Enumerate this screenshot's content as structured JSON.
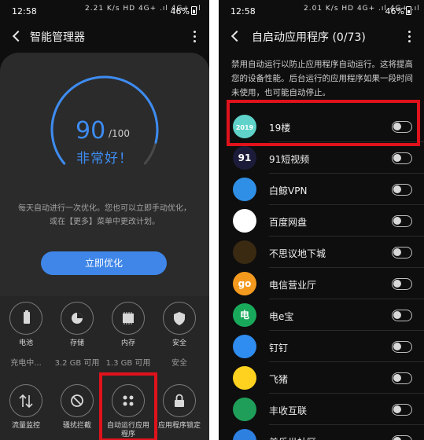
{
  "left_screen": {
    "status_bar": {
      "time": "12:58",
      "system_icons": "2.21 K/s HD 4G+ .ıl 4G+ .ıl",
      "battery": "46%"
    },
    "app_bar": {
      "title": "智能管理器"
    },
    "score": {
      "value": "90",
      "max": "/100",
      "fraction": 0.9,
      "status": "非常好！"
    },
    "description": "每天自动进行一次优化。您也可以立即手动优化，或在【更多】菜单中更改计划。",
    "optimize_button": "立即优化",
    "tiles_row1": [
      {
        "label": "电池",
        "value": "充电中...",
        "icon": "battery-icon"
      },
      {
        "label": "存储",
        "value": "3.2 GB 可用",
        "icon": "pie-chart-icon"
      },
      {
        "label": "内存",
        "value": "1.3 GB 可用",
        "icon": "memory-chip-icon"
      },
      {
        "label": "安全",
        "value": "安全",
        "icon": "shield-icon"
      }
    ],
    "tiles_row2": [
      {
        "label": "流量监控",
        "icon": "up-down-arrows-icon"
      },
      {
        "label": "骚扰拦截",
        "icon": "block-icon"
      },
      {
        "label": "自动运行应用程序",
        "icon": "apps-grid-icon"
      },
      {
        "label": "应用程序锁定",
        "icon": "lock-icon"
      }
    ],
    "highlight_color": "#e0121b",
    "accent_color": "#3d8cf2"
  },
  "right_screen": {
    "status_bar": {
      "time": "12:58",
      "system_icons": "2.01 K/s HD 4G+ .ıl 4G+ .ıl",
      "battery": "46%"
    },
    "app_bar": {
      "title": "自启动应用程序 (0/73)"
    },
    "intro": "禁用自动运行以防止应用程序自动运行。这将提高您的设备性能。后台运行的应用程序如果一段时间未使用，也可能自动停止。",
    "apps": [
      {
        "name": "19楼",
        "icon": "app-19lou-icon",
        "icon_text": "2019",
        "color": "#5fd3c9",
        "enabled": false
      },
      {
        "name": "91短视频",
        "icon": "app-91-icon",
        "icon_text": "91",
        "color": "#1c1c3a",
        "enabled": false
      },
      {
        "name": "白鲸VPN",
        "icon": "app-whale-icon",
        "icon_text": "",
        "color": "#2f8fe6",
        "enabled": false
      },
      {
        "name": "百度网盘",
        "icon": "app-baidu-pan-icon",
        "icon_text": "",
        "color": "#ffffff",
        "enabled": false
      },
      {
        "name": "不思议地下城",
        "icon": "app-dungeon-icon",
        "icon_text": "",
        "color": "#3a2a12",
        "enabled": false
      },
      {
        "name": "电信营业厅",
        "icon": "app-telecom-icon",
        "icon_text": "go",
        "color": "#f39a1e",
        "enabled": false
      },
      {
        "name": "电e宝",
        "icon": "app-dianebao-icon",
        "icon_text": "电",
        "color": "#19a95a",
        "enabled": false
      },
      {
        "name": "钉钉",
        "icon": "app-dingtalk-icon",
        "icon_text": "",
        "color": "#2f8cf0",
        "enabled": false
      },
      {
        "name": "飞猪",
        "icon": "app-fliggy-icon",
        "icon_text": "",
        "color": "#ffd21f",
        "enabled": false
      },
      {
        "name": "丰收互联",
        "icon": "app-fengshou-icon",
        "icon_text": "",
        "color": "#1f9e5a",
        "enabled": false
      },
      {
        "name": "美乐世社区",
        "icon": "app-community-icon",
        "icon_text": "",
        "color": "#2d7fe0",
        "enabled": false
      }
    ]
  }
}
